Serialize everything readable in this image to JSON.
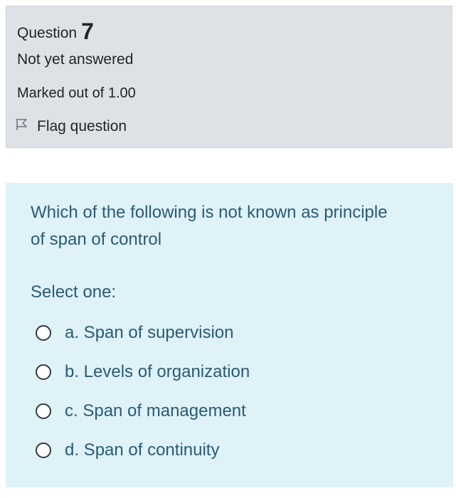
{
  "question_info": {
    "heading_label": "Question",
    "number": "7",
    "state": "Not yet answered",
    "grade": "Marked out of 1.00",
    "flag_label": "Flag question"
  },
  "question": {
    "text": "Which of the following is not known as principle of span of control",
    "prompt": "Select one:",
    "answers": [
      {
        "label": "a. Span of supervision"
      },
      {
        "label": "b. Levels of organization"
      },
      {
        "label": "c. Span of management"
      },
      {
        "label": "d. Span of continuity"
      }
    ]
  },
  "colors": {
    "info_bg": "#dee2e6",
    "content_bg": "#def2f8",
    "question_text": "#2b5a73",
    "info_text": "#212529"
  },
  "icons": {
    "flag": "flag-outline-icon",
    "radio": "radio-unchecked-icon"
  }
}
